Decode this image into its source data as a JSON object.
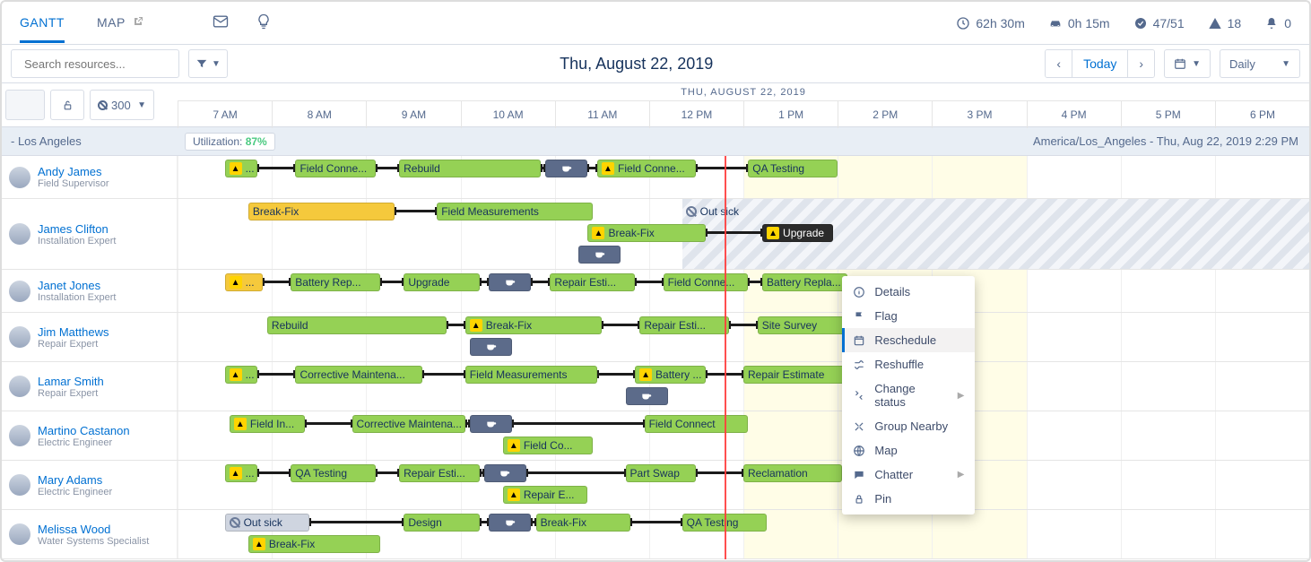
{
  "tabs": {
    "gantt": "GANTT",
    "map": "MAP"
  },
  "stats": {
    "time": "62h 30m",
    "drive": "0h 15m",
    "completed": "47/51",
    "violations": "18",
    "alerts": "0"
  },
  "search": {
    "placeholder": "Search resources..."
  },
  "center_date": "Thu, August 22, 2019",
  "today_label": "Today",
  "view_mode": "Daily",
  "lock": "",
  "zoom": "300",
  "timeline_date": "THU, AUGUST 22, 2019",
  "hours": [
    "7 AM",
    "8 AM",
    "9 AM",
    "10 AM",
    "11 AM",
    "12 PM",
    "1 PM",
    "2 PM",
    "3 PM",
    "4 PM",
    "5 PM",
    "6 PM"
  ],
  "region": "- Los Angeles",
  "utilization_label": "Utilization:",
  "utilization_value": "87%",
  "timezone_info": "America/Los_Angeles - Thu, Aug 22, 2019 2:29 PM",
  "resources": [
    {
      "name": "Andy James",
      "role": "Field Supervisor"
    },
    {
      "name": "James Clifton",
      "role": "Installation Expert"
    },
    {
      "name": "Janet Jones",
      "role": "Installation Expert"
    },
    {
      "name": "Jim Matthews",
      "role": "Repair Expert"
    },
    {
      "name": "Lamar Smith",
      "role": "Repair Expert"
    },
    {
      "name": "Martino Castanon",
      "role": "Electric Engineer"
    },
    {
      "name": "Mary Adams",
      "role": "Electric Engineer"
    },
    {
      "name": "Melissa Wood",
      "role": "Water Systems Specialist"
    }
  ],
  "appointments": {
    "andy": [
      {
        "label": "...",
        "color": "green",
        "warn": true,
        "start": 7,
        "end": 7.35
      },
      {
        "label": "Field Conne...",
        "color": "green",
        "start": 7.75,
        "end": 8.6
      },
      {
        "label": "Rebuild",
        "color": "green",
        "start": 8.85,
        "end": 10.35
      },
      {
        "label": "",
        "color": "slate",
        "cup": true,
        "start": 10.4,
        "end": 10.85
      },
      {
        "label": "Field Conne...",
        "color": "green",
        "warn": true,
        "start": 10.95,
        "end": 12.0
      },
      {
        "label": "QA Testing",
        "color": "green",
        "start": 12.55,
        "end": 13.5
      }
    ],
    "james_a": [
      {
        "label": "Break-Fix",
        "color": "yellow",
        "start": 7.25,
        "end": 8.8
      },
      {
        "label": "Field Measurements",
        "color": "green",
        "start": 9.25,
        "end": 10.9
      },
      {
        "label": "Out sick",
        "color": "absence-label",
        "ban": true,
        "start": 11.85,
        "end": 18
      }
    ],
    "james_b": [
      {
        "label": "Break-Fix",
        "color": "green",
        "warn": true,
        "start": 10.85,
        "end": 12.1
      },
      {
        "label": "Upgrade",
        "color": "dark",
        "warn": true,
        "start": 12.7,
        "end": 13.45
      }
    ],
    "james_c": [
      {
        "label": "",
        "color": "slate",
        "cup": true,
        "start": 10.75,
        "end": 11.2
      }
    ],
    "janet_a": [
      {
        "label": "...",
        "color": "yellow",
        "warn": true,
        "start": 7,
        "end": 7.4
      },
      {
        "label": "Battery Rep...",
        "color": "green",
        "start": 7.7,
        "end": 8.65
      },
      {
        "label": "Upgrade",
        "color": "green",
        "start": 8.9,
        "end": 9.7
      },
      {
        "label": "",
        "color": "slate",
        "cup": true,
        "start": 9.8,
        "end": 10.25
      },
      {
        "label": "Repair Esti...",
        "color": "green",
        "start": 10.45,
        "end": 11.35
      },
      {
        "label": "Field Conne...",
        "color": "green",
        "start": 11.65,
        "end": 12.55
      },
      {
        "label": "Battery Repla...",
        "color": "green",
        "start": 12.7,
        "end": 13.6
      }
    ],
    "jim_a": [
      {
        "label": "Rebuild",
        "color": "green",
        "start": 7.45,
        "end": 9.35
      },
      {
        "label": "Break-Fix",
        "color": "green",
        "warn": true,
        "start": 9.55,
        "end": 11.0
      },
      {
        "label": "Repair Esti...",
        "color": "green",
        "start": 11.4,
        "end": 12.35
      },
      {
        "label": "Site Survey",
        "color": "green",
        "start": 12.65,
        "end": 13.6
      }
    ],
    "jim_b": [
      {
        "label": "",
        "color": "slate",
        "cup": true,
        "start": 9.6,
        "end": 10.05
      }
    ],
    "lamar_a": [
      {
        "label": "...",
        "color": "green",
        "warn": true,
        "start": 7.0,
        "end": 7.35
      },
      {
        "label": "Corrective Maintena...",
        "color": "green",
        "start": 7.75,
        "end": 9.1
      },
      {
        "label": "Field Measurements",
        "color": "green",
        "start": 9.55,
        "end": 10.95
      },
      {
        "label": "Battery ...",
        "color": "green",
        "warn": true,
        "start": 11.35,
        "end": 12.1
      },
      {
        "label": "Repair Estimate",
        "color": "green",
        "start": 12.5,
        "end": 13.6
      }
    ],
    "lamar_b": [
      {
        "label": "",
        "color": "slate",
        "cup": true,
        "start": 11.25,
        "end": 11.7
      }
    ],
    "martino_a": [
      {
        "label": "Field In...",
        "color": "green",
        "warn": true,
        "start": 7.05,
        "end": 7.85
      },
      {
        "label": "Corrective Maintena...",
        "color": "green",
        "start": 8.35,
        "end": 9.55
      },
      {
        "label": "",
        "color": "slate",
        "cup": true,
        "start": 9.6,
        "end": 10.05
      },
      {
        "label": "Field Connect",
        "color": "green",
        "start": 11.45,
        "end": 12.55
      }
    ],
    "martino_b": [
      {
        "label": "Field Co...",
        "color": "green",
        "warn": true,
        "start": 9.95,
        "end": 10.9
      }
    ],
    "mary_a": [
      {
        "label": "...",
        "color": "green",
        "warn": true,
        "start": 7,
        "end": 7.35
      },
      {
        "label": "QA Testing",
        "color": "green",
        "start": 7.7,
        "end": 8.6
      },
      {
        "label": "Repair Esti...",
        "color": "green",
        "start": 8.85,
        "end": 9.7
      },
      {
        "label": "",
        "color": "slate",
        "cup": true,
        "start": 9.75,
        "end": 10.2
      },
      {
        "label": "Part Swap",
        "color": "green",
        "start": 11.25,
        "end": 12.0
      },
      {
        "label": "Reclamation",
        "color": "green",
        "start": 12.5,
        "end": 13.55
      }
    ],
    "mary_b": [
      {
        "label": "Repair E...",
        "color": "green",
        "warn": true,
        "start": 9.95,
        "end": 10.85
      }
    ],
    "melissa_a": [
      {
        "label": "Out sick",
        "color": "gray",
        "ban": true,
        "start": 7,
        "end": 7.9
      },
      {
        "label": "Design",
        "color": "green",
        "start": 8.9,
        "end": 9.7
      },
      {
        "label": "",
        "color": "slate",
        "cup": true,
        "start": 9.8,
        "end": 10.25
      },
      {
        "label": "Break-Fix",
        "color": "green",
        "start": 10.3,
        "end": 11.3
      },
      {
        "label": "QA Testing",
        "color": "green",
        "start": 11.85,
        "end": 12.75
      }
    ],
    "melissa_b": [
      {
        "label": "Break-Fix",
        "color": "green",
        "warn": true,
        "start": 7.25,
        "end": 8.65
      }
    ]
  },
  "context_menu": {
    "items": [
      "Details",
      "Flag",
      "Reschedule",
      "Reshuffle",
      "Change status",
      "Group Nearby",
      "Map",
      "Chatter",
      "Pin"
    ],
    "selected": "Reschedule",
    "submenu": [
      "Change status",
      "Chatter"
    ]
  },
  "now": 12.3
}
